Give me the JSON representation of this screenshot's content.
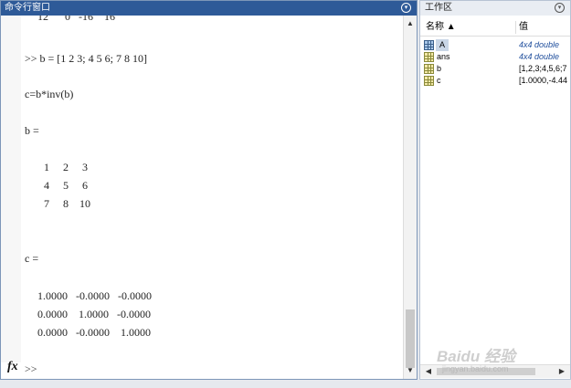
{
  "command_window": {
    "title": "命令行窗口",
    "menu_glyph": "▾",
    "lines": [
      {
        "text": "  12      0   -16    16"
      },
      {
        "text": ">> b = [1 2 3; 4 5 6; 7 8 10]"
      },
      {
        "text": "c=b*inv(b)"
      },
      {
        "text": "b ="
      },
      {
        "text": "     1     2     3"
      },
      {
        "text": "     4     5     6"
      },
      {
        "text": "     7     8    10"
      },
      {
        "text": "c ="
      },
      {
        "text": "    1.0000   -0.0000   -0.0000"
      },
      {
        "text": "    0.0000    1.0000   -0.0000"
      },
      {
        "text": "    0.0000   -0.0000    1.0000"
      }
    ],
    "fx_label": "fx",
    "prompt": ">>",
    "scroll_up": "▲",
    "scroll_down": "▼"
  },
  "workspace": {
    "title": "工作区",
    "menu_glyph": "▾",
    "col_name": "名称 ▲",
    "col_value": "值",
    "rows": [
      {
        "name": "A",
        "value": "4x4 double"
      },
      {
        "name": "ans",
        "value": "4x4 double"
      },
      {
        "name": "b",
        "value": "[1,2,3;4,5,6;7"
      },
      {
        "name": "c",
        "value": "[1.0000,-4.44"
      }
    ],
    "scroll_left": "◀",
    "scroll_right": "▶"
  },
  "watermark": {
    "text": "Baidu 经验",
    "sub": "jingyan.baidu.com"
  }
}
